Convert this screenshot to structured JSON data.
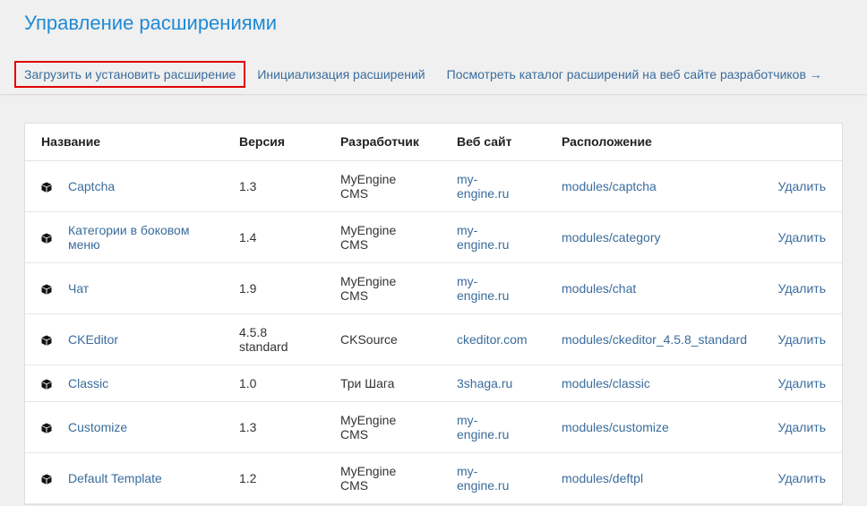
{
  "page": {
    "title": "Управление расширениями"
  },
  "subnav": {
    "upload": "Загрузить и установить расширение",
    "init": "Инициализация расширений",
    "catalog": "Посмотреть каталог расширений на веб сайте разработчиков →"
  },
  "table": {
    "headers": {
      "name": "Название",
      "version": "Версия",
      "developer": "Разработчик",
      "website": "Веб сайт",
      "location": "Расположение"
    },
    "delete_label": "Удалить",
    "rows": [
      {
        "name": "Captcha",
        "version": "1.3",
        "developer": "MyEngine CMS",
        "website": "my-engine.ru",
        "location": "modules/captcha",
        "short": false
      },
      {
        "name": "Категории в боковом меню",
        "version": "1.4",
        "developer": "MyEngine CMS",
        "website": "my-engine.ru",
        "location": "modules/category",
        "short": false
      },
      {
        "name": "Чат",
        "version": "1.9",
        "developer": "MyEngine CMS",
        "website": "my-engine.ru",
        "location": "modules/chat",
        "short": false
      },
      {
        "name": "CKEditor",
        "version": "4.5.8 standard",
        "developer": "CKSource",
        "website": "ckeditor.com",
        "location": "modules/ckeditor_4.5.8_standard",
        "short": false
      },
      {
        "name": "Classic",
        "version": "1.0",
        "developer": "Три Шага",
        "website": "3shaga.ru",
        "location": "modules/classic",
        "short": true
      },
      {
        "name": "Customize",
        "version": "1.3",
        "developer": "MyEngine CMS",
        "website": "my-engine.ru",
        "location": "modules/customize",
        "short": false
      },
      {
        "name": "Default Template",
        "version": "1.2",
        "developer": "MyEngine CMS",
        "website": "my-engine.ru",
        "location": "modules/deftpl",
        "short": false
      }
    ]
  },
  "colors": {
    "title": "#1e8ad6",
    "link": "#3a6c9c",
    "active_border": "#e00000"
  },
  "icons": {
    "extension": "cube-icon"
  }
}
